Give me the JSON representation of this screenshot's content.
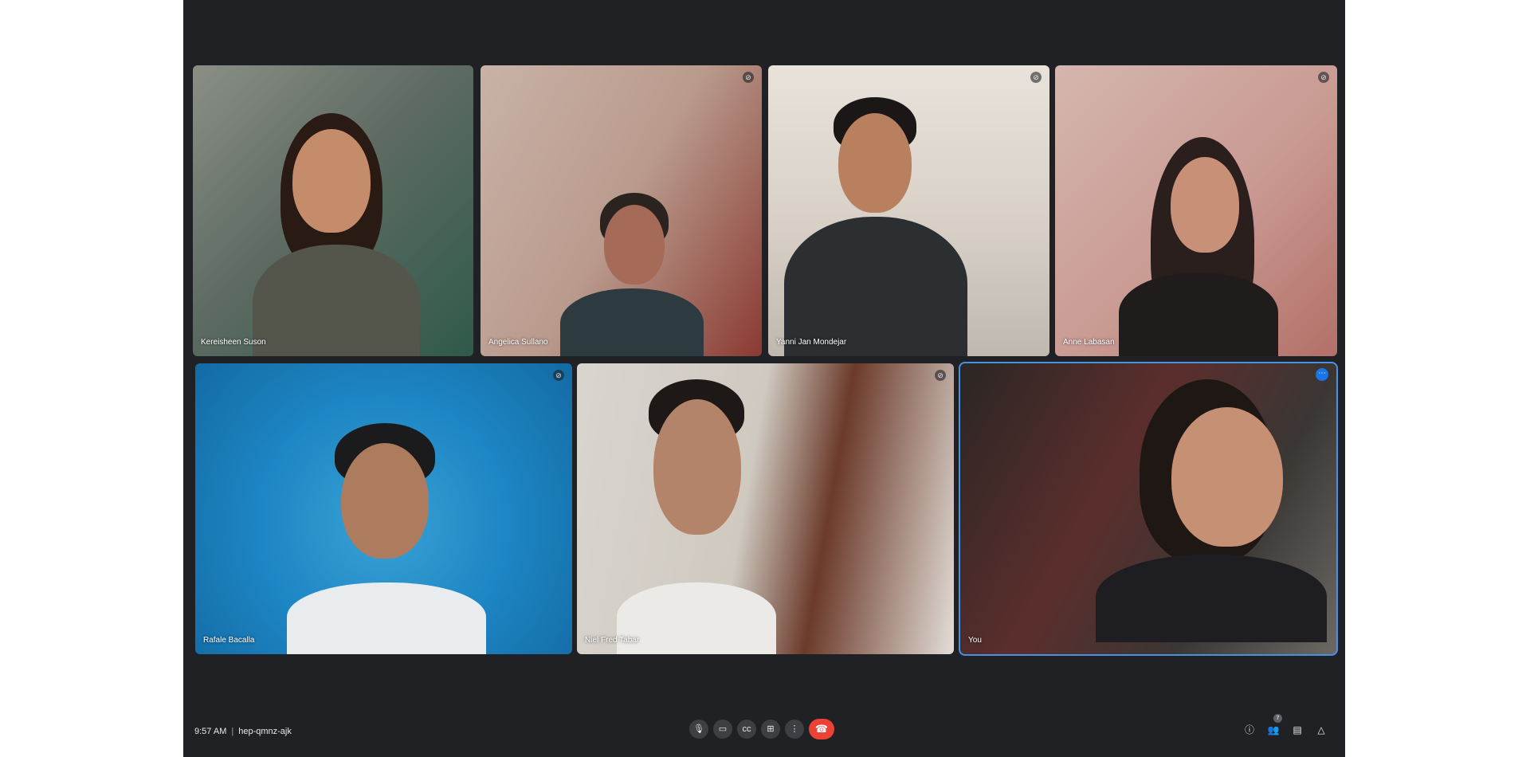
{
  "participants": [
    {
      "name": "Kereisheen Suson",
      "muted": false
    },
    {
      "name": "Angelica Sullano",
      "muted": true
    },
    {
      "name": "Yanni Jan Mondejar",
      "muted": true
    },
    {
      "name": "Anne Labasan",
      "muted": true
    },
    {
      "name": "Rafale Bacalla",
      "muted": true
    },
    {
      "name": "Niel Fred Tabar",
      "muted": true
    },
    {
      "name": "You",
      "muted": false,
      "active": true
    }
  ],
  "meeting": {
    "time": "9:57 AM",
    "separator": "|",
    "code": "hep-qmnz-ajk"
  },
  "controls": {
    "mic_icon": "microphone-icon",
    "camera_icon": "camera-icon",
    "captions_icon": "captions-icon",
    "present_icon": "present-screen-icon",
    "more_icon": "more-options-icon",
    "end_icon": "end-call-icon"
  },
  "right_panel": {
    "people_count": "7"
  },
  "colors": {
    "stage_bg": "#202124",
    "accent": "#1a73e8",
    "end_call": "#ea4335"
  }
}
